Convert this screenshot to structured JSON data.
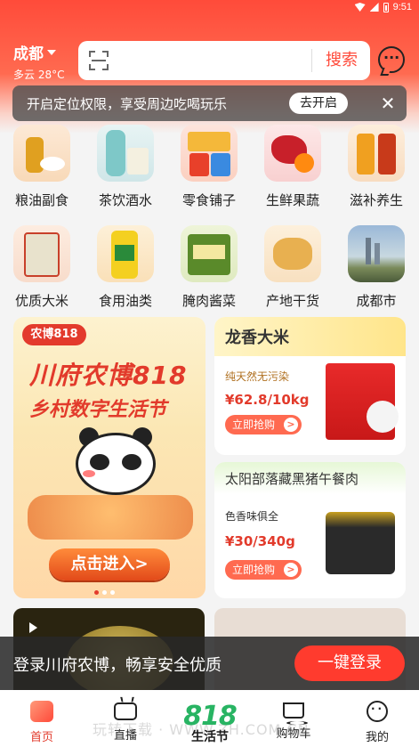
{
  "status_bar": {
    "time": "9:51"
  },
  "header": {
    "city": "成都",
    "weather": "多云 28°C",
    "search_button": "搜索"
  },
  "location_banner": {
    "text": "开启定位权限，享受周边吃喝玩乐",
    "button": "去开启",
    "close": "✕"
  },
  "categories": [
    {
      "label": "粮油副食"
    },
    {
      "label": "茶饮酒水"
    },
    {
      "label": "零食铺子"
    },
    {
      "label": "生鲜果蔬"
    },
    {
      "label": "滋补养生"
    },
    {
      "label": "优质大米"
    },
    {
      "label": "食用油类"
    },
    {
      "label": "腌肉酱菜"
    },
    {
      "label": "产地干货"
    },
    {
      "label": "成都市"
    }
  ],
  "promo_left": {
    "logo": "农博818",
    "line1": "川府农博818",
    "line2": "乡村数字生活节",
    "button": "点击进入>"
  },
  "promo_rice": {
    "title": "龙香大米",
    "subtitle": "纯天然无污染",
    "price": "¥62.8/10kg",
    "button": "立即抢购"
  },
  "promo_pork": {
    "title": "太阳部落藏黑猪午餐肉",
    "subtitle": "色香味俱全",
    "price": "¥30/340g",
    "button": "立即抢购"
  },
  "login_banner": {
    "text": "登录川府农博，畅享安全优质",
    "button": "一键登录"
  },
  "bottom_nav": {
    "home": "首页",
    "live": "直播",
    "center_big": "818",
    "center_small": "生活节",
    "cart": "购物车",
    "me": "我的"
  },
  "watermark": "玩转下载 · WWW.ZH.COM.CN",
  "colors": {
    "brand_red": "#ff4a3a",
    "accent_green": "#28b463"
  }
}
